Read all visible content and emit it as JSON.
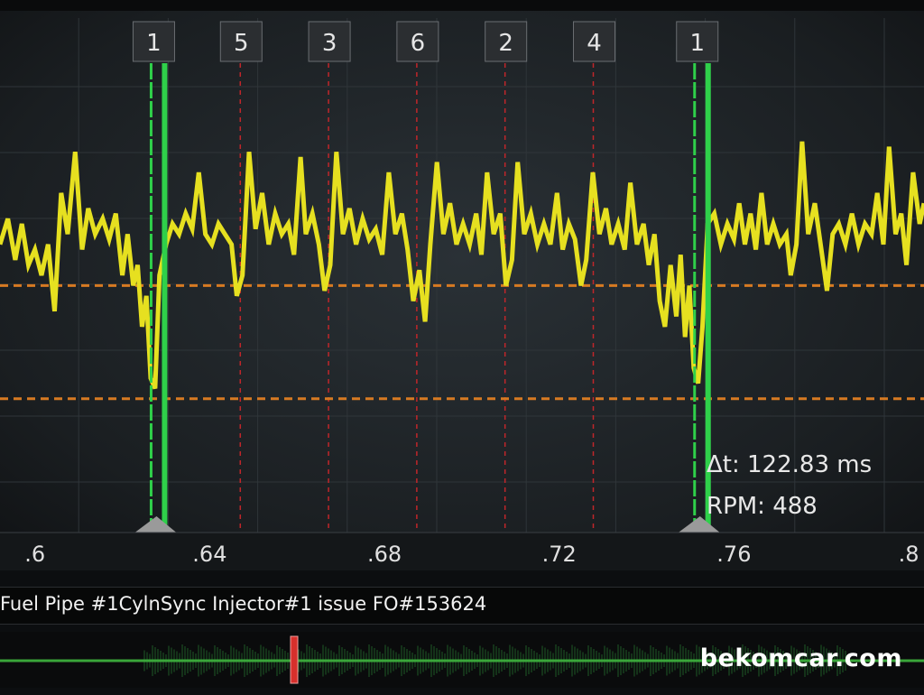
{
  "chart_data": {
    "type": "line",
    "x_ticks": [
      {
        "value": 0.6,
        "label": ".6"
      },
      {
        "value": 0.64,
        "label": ".64"
      },
      {
        "value": 0.68,
        "label": ".68"
      },
      {
        "value": 0.72,
        "label": ".72"
      },
      {
        "value": 0.76,
        "label": ".76"
      },
      {
        "value": 0.8,
        "label": ".8"
      }
    ],
    "xlim": [
      0.592,
      0.8035
    ],
    "cylinder_markers": [
      {
        "label": "1",
        "t": 0.627,
        "kind": "cursor"
      },
      {
        "label": "5",
        "t": 0.647,
        "kind": "sync"
      },
      {
        "label": "3",
        "t": 0.6672,
        "kind": "sync"
      },
      {
        "label": "6",
        "t": 0.6874,
        "kind": "sync"
      },
      {
        "label": "2",
        "t": 0.7076,
        "kind": "sync"
      },
      {
        "label": "4",
        "t": 0.7278,
        "kind": "sync"
      },
      {
        "label": "1",
        "t": 0.7514,
        "kind": "cursor"
      }
    ],
    "threshold_levels": [
      0.48,
      0.26
    ],
    "series": [
      {
        "color": "#e6e020",
        "points": [
          [
            0.592,
            0.56
          ],
          [
            0.5938,
            0.61
          ],
          [
            0.5955,
            0.53
          ],
          [
            0.597,
            0.6
          ],
          [
            0.5985,
            0.52
          ],
          [
            0.6,
            0.55
          ],
          [
            0.6015,
            0.5
          ],
          [
            0.603,
            0.56
          ],
          [
            0.6045,
            0.43
          ],
          [
            0.606,
            0.66
          ],
          [
            0.6075,
            0.58
          ],
          [
            0.6092,
            0.74
          ],
          [
            0.6108,
            0.55
          ],
          [
            0.6122,
            0.63
          ],
          [
            0.6138,
            0.58
          ],
          [
            0.6155,
            0.61
          ],
          [
            0.617,
            0.57
          ],
          [
            0.6185,
            0.62
          ],
          [
            0.62,
            0.5
          ],
          [
            0.6212,
            0.58
          ],
          [
            0.6225,
            0.48
          ],
          [
            0.6235,
            0.52
          ],
          [
            0.6245,
            0.4
          ],
          [
            0.6255,
            0.46
          ],
          [
            0.6265,
            0.3
          ],
          [
            0.6275,
            0.28
          ],
          [
            0.6285,
            0.5
          ],
          [
            0.63,
            0.56
          ],
          [
            0.6315,
            0.6
          ],
          [
            0.633,
            0.58
          ],
          [
            0.6345,
            0.62
          ],
          [
            0.636,
            0.59
          ],
          [
            0.6375,
            0.7
          ],
          [
            0.639,
            0.58
          ],
          [
            0.6405,
            0.56
          ],
          [
            0.642,
            0.6
          ],
          [
            0.6435,
            0.58
          ],
          [
            0.645,
            0.56
          ],
          [
            0.6462,
            0.46
          ],
          [
            0.6475,
            0.5
          ],
          [
            0.649,
            0.74
          ],
          [
            0.6505,
            0.59
          ],
          [
            0.652,
            0.66
          ],
          [
            0.6535,
            0.56
          ],
          [
            0.655,
            0.62
          ],
          [
            0.6565,
            0.58
          ],
          [
            0.658,
            0.6
          ],
          [
            0.6593,
            0.54
          ],
          [
            0.6608,
            0.73
          ],
          [
            0.662,
            0.58
          ],
          [
            0.6635,
            0.62
          ],
          [
            0.665,
            0.56
          ],
          [
            0.6663,
            0.47
          ],
          [
            0.6676,
            0.52
          ],
          [
            0.669,
            0.74
          ],
          [
            0.6705,
            0.58
          ],
          [
            0.672,
            0.63
          ],
          [
            0.6735,
            0.56
          ],
          [
            0.675,
            0.61
          ],
          [
            0.6765,
            0.57
          ],
          [
            0.678,
            0.59
          ],
          [
            0.6795,
            0.54
          ],
          [
            0.681,
            0.7
          ],
          [
            0.6825,
            0.58
          ],
          [
            0.684,
            0.62
          ],
          [
            0.6853,
            0.55
          ],
          [
            0.6866,
            0.45
          ],
          [
            0.688,
            0.51
          ],
          [
            0.6893,
            0.41
          ],
          [
            0.6905,
            0.56
          ],
          [
            0.692,
            0.72
          ],
          [
            0.6935,
            0.58
          ],
          [
            0.695,
            0.64
          ],
          [
            0.6965,
            0.56
          ],
          [
            0.698,
            0.6
          ],
          [
            0.6995,
            0.56
          ],
          [
            0.701,
            0.62
          ],
          [
            0.7022,
            0.54
          ],
          [
            0.7035,
            0.7
          ],
          [
            0.705,
            0.58
          ],
          [
            0.7065,
            0.62
          ],
          [
            0.7078,
            0.48
          ],
          [
            0.7092,
            0.53
          ],
          [
            0.7105,
            0.72
          ],
          [
            0.712,
            0.58
          ],
          [
            0.7135,
            0.62
          ],
          [
            0.715,
            0.56
          ],
          [
            0.7165,
            0.6
          ],
          [
            0.718,
            0.56
          ],
          [
            0.7195,
            0.66
          ],
          [
            0.7208,
            0.55
          ],
          [
            0.7222,
            0.6
          ],
          [
            0.7236,
            0.57
          ],
          [
            0.725,
            0.48
          ],
          [
            0.7262,
            0.53
          ],
          [
            0.7277,
            0.7
          ],
          [
            0.7292,
            0.58
          ],
          [
            0.7307,
            0.63
          ],
          [
            0.732,
            0.56
          ],
          [
            0.7335,
            0.6
          ],
          [
            0.735,
            0.55
          ],
          [
            0.7363,
            0.68
          ],
          [
            0.7378,
            0.56
          ],
          [
            0.7393,
            0.6
          ],
          [
            0.7405,
            0.52
          ],
          [
            0.7418,
            0.58
          ],
          [
            0.743,
            0.45
          ],
          [
            0.7442,
            0.4
          ],
          [
            0.7455,
            0.52
          ],
          [
            0.7468,
            0.42
          ],
          [
            0.7478,
            0.54
          ],
          [
            0.7488,
            0.38
          ],
          [
            0.7498,
            0.48
          ],
          [
            0.7508,
            0.32
          ],
          [
            0.7518,
            0.29
          ],
          [
            0.7528,
            0.4
          ],
          [
            0.754,
            0.6
          ],
          [
            0.7555,
            0.62
          ],
          [
            0.757,
            0.56
          ],
          [
            0.7585,
            0.6
          ],
          [
            0.76,
            0.57
          ],
          [
            0.7612,
            0.64
          ],
          [
            0.7625,
            0.56
          ],
          [
            0.7638,
            0.62
          ],
          [
            0.765,
            0.55
          ],
          [
            0.7663,
            0.66
          ],
          [
            0.7676,
            0.56
          ],
          [
            0.769,
            0.6
          ],
          [
            0.7705,
            0.56
          ],
          [
            0.772,
            0.58
          ],
          [
            0.773,
            0.5
          ],
          [
            0.7743,
            0.56
          ],
          [
            0.7756,
            0.76
          ],
          [
            0.777,
            0.58
          ],
          [
            0.7785,
            0.64
          ],
          [
            0.78,
            0.55
          ],
          [
            0.7813,
            0.47
          ],
          [
            0.7826,
            0.58
          ],
          [
            0.784,
            0.6
          ],
          [
            0.7855,
            0.56
          ],
          [
            0.787,
            0.62
          ],
          [
            0.7885,
            0.56
          ],
          [
            0.79,
            0.6
          ],
          [
            0.7915,
            0.58
          ],
          [
            0.7928,
            0.66
          ],
          [
            0.7942,
            0.56
          ],
          [
            0.7955,
            0.75
          ],
          [
            0.797,
            0.58
          ],
          [
            0.7983,
            0.62
          ],
          [
            0.7995,
            0.52
          ],
          [
            0.801,
            0.7
          ],
          [
            0.8025,
            0.6
          ],
          [
            0.8035,
            0.64
          ]
        ]
      }
    ],
    "readouts": {
      "delta_t": "Δt: 122.83 ms",
      "rpm": "RPM: 488"
    }
  },
  "caption": "Fuel Pipe #1CylnSync Injector#1 issue FO#153624",
  "watermark": "bekomcar.com",
  "colors": {
    "trace": "#e6e020",
    "cursor": "#2fd04a",
    "sync_line": "#c0262a",
    "threshold": "#d77a22",
    "overview_line": "#3aa63a",
    "overview_marker": "#d7302c"
  }
}
